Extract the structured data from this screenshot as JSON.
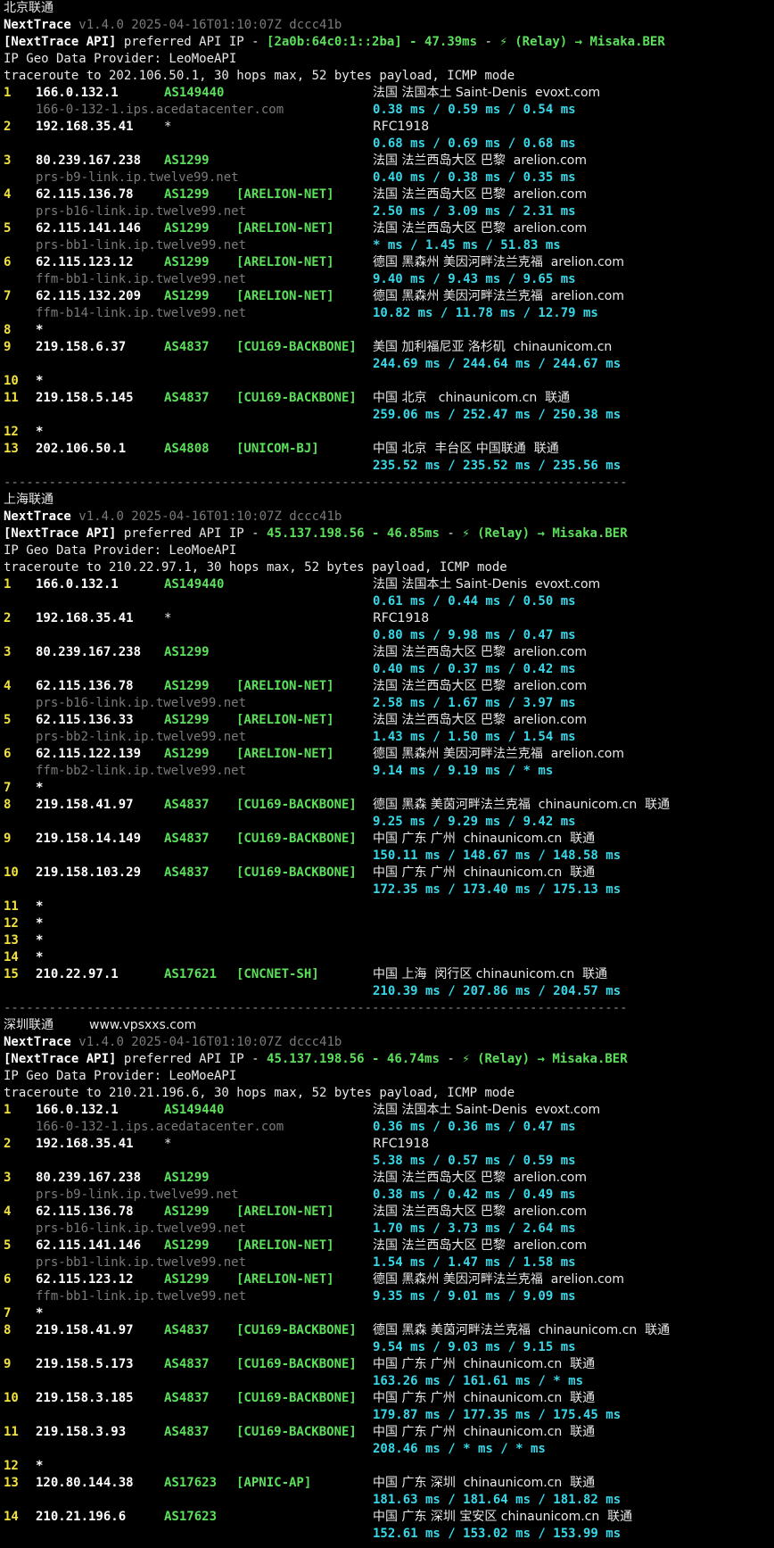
{
  "terminal": {
    "sections": [
      {
        "title": "北京联通",
        "note": "",
        "version": "v1.4.0 2025-04-16T01:10:07Z dccc41b",
        "api_ip": "[2a0b:64c0:1::2ba]",
        "api_latency": "47.39ms",
        "relay": "(Relay) → Misaka.BER",
        "geo_provider": "IP Geo Data Provider: LeoMoeAPI",
        "traceroute": "traceroute to 202.106.50.1, 30 hops max, 52 bytes payload, ICMP mode",
        "hops": [
          {
            "n": "1",
            "ip": "166.0.132.1",
            "as": "AS149440",
            "tag": "",
            "geo": "法国 法国本土 Saint-Denis  evoxt.com",
            "host": "166-0-132-1.ips.acedatacenter.com",
            "rtt": "0.38 ms / 0.59 ms / 0.54 ms"
          },
          {
            "n": "2",
            "ip": "192.168.35.41",
            "as": "*",
            "tag": "",
            "geo": "RFC1918",
            "host": "",
            "rtt": "0.68 ms / 0.69 ms / 0.68 ms"
          },
          {
            "n": "3",
            "ip": "80.239.167.238",
            "as": "AS1299",
            "tag": "",
            "geo": "法国 法兰西岛大区 巴黎  arelion.com",
            "host": "prs-b9-link.ip.twelve99.net",
            "rtt": "0.40 ms / 0.38 ms / 0.35 ms"
          },
          {
            "n": "4",
            "ip": "62.115.136.78",
            "as": "AS1299",
            "tag": "[ARELION-NET]",
            "geo": "法国 法兰西岛大区 巴黎  arelion.com",
            "host": "prs-b16-link.ip.twelve99.net",
            "rtt": "2.50 ms / 3.09 ms / 2.31 ms"
          },
          {
            "n": "5",
            "ip": "62.115.141.146",
            "as": "AS1299",
            "tag": "[ARELION-NET]",
            "geo": "法国 法兰西岛大区 巴黎  arelion.com",
            "host": "prs-bb1-link.ip.twelve99.net",
            "rtt": "* ms / 1.45 ms / 51.83 ms"
          },
          {
            "n": "6",
            "ip": "62.115.123.12",
            "as": "AS1299",
            "tag": "[ARELION-NET]",
            "geo": "德国 黑森州 美因河畔法兰克福  arelion.com",
            "host": "ffm-bb1-link.ip.twelve99.net",
            "rtt": "9.40 ms / 9.43 ms / 9.65 ms"
          },
          {
            "n": "7",
            "ip": "62.115.132.209",
            "as": "AS1299",
            "tag": "[ARELION-NET]",
            "geo": "德国 黑森州 美因河畔法兰克福  arelion.com",
            "host": "ffm-b14-link.ip.twelve99.net",
            "rtt": "10.82 ms / 11.78 ms / 12.79 ms"
          },
          {
            "n": "8",
            "ip": "*",
            "as": "",
            "tag": "",
            "geo": "",
            "host": "",
            "rtt": ""
          },
          {
            "n": "9",
            "ip": "219.158.6.37",
            "as": "AS4837",
            "tag": "[CU169-BACKBONE]",
            "geo": "美国 加利福尼亚 洛杉矶  chinaunicom.cn",
            "host": "",
            "rtt": "244.69 ms / 244.64 ms / 244.67 ms"
          },
          {
            "n": "10",
            "ip": "*",
            "as": "",
            "tag": "",
            "geo": "",
            "host": "",
            "rtt": ""
          },
          {
            "n": "11",
            "ip": "219.158.5.145",
            "as": "AS4837",
            "tag": "[CU169-BACKBONE]",
            "geo": "中国 北京   chinaunicom.cn  联通",
            "host": "",
            "rtt": "259.06 ms / 252.47 ms / 250.38 ms"
          },
          {
            "n": "12",
            "ip": "*",
            "as": "",
            "tag": "",
            "geo": "",
            "host": "",
            "rtt": ""
          },
          {
            "n": "13",
            "ip": "202.106.50.1",
            "as": "AS4808",
            "tag": "[UNICOM-BJ]",
            "geo": "中国 北京  丰台区 中国联通  联通",
            "host": "",
            "rtt": "235.52 ms / 235.52 ms / 235.56 ms"
          }
        ]
      },
      {
        "title": "上海联通",
        "note": "",
        "version": "v1.4.0 2025-04-16T01:10:07Z dccc41b",
        "api_ip": "45.137.198.56",
        "api_latency": "46.85ms",
        "relay": "(Relay) → Misaka.BER",
        "geo_provider": "IP Geo Data Provider: LeoMoeAPI",
        "traceroute": "traceroute to 210.22.97.1, 30 hops max, 52 bytes payload, ICMP mode",
        "hops": [
          {
            "n": "1",
            "ip": "166.0.132.1",
            "as": "AS149440",
            "tag": "",
            "geo": "法国 法国本土 Saint-Denis  evoxt.com",
            "host": "",
            "rtt": "0.61 ms / 0.44 ms / 0.50 ms"
          },
          {
            "n": "2",
            "ip": "192.168.35.41",
            "as": "*",
            "tag": "",
            "geo": "RFC1918",
            "host": "",
            "rtt": "0.80 ms / 9.98 ms / 0.47 ms"
          },
          {
            "n": "3",
            "ip": "80.239.167.238",
            "as": "AS1299",
            "tag": "",
            "geo": "法国 法兰西岛大区 巴黎  arelion.com",
            "host": "",
            "rtt": "0.40 ms / 0.37 ms / 0.42 ms"
          },
          {
            "n": "4",
            "ip": "62.115.136.78",
            "as": "AS1299",
            "tag": "[ARELION-NET]",
            "geo": "法国 法兰西岛大区 巴黎  arelion.com",
            "host": "prs-b16-link.ip.twelve99.net",
            "rtt": "2.58 ms / 1.67 ms / 3.97 ms"
          },
          {
            "n": "5",
            "ip": "62.115.136.33",
            "as": "AS1299",
            "tag": "[ARELION-NET]",
            "geo": "法国 法兰西岛大区 巴黎  arelion.com",
            "host": "prs-bb2-link.ip.twelve99.net",
            "rtt": "1.43 ms / 1.50 ms / 1.54 ms"
          },
          {
            "n": "6",
            "ip": "62.115.122.139",
            "as": "AS1299",
            "tag": "[ARELION-NET]",
            "geo": "德国 黑森州 美因河畔法兰克福  arelion.com",
            "host": "ffm-bb2-link.ip.twelve99.net",
            "rtt": "9.14 ms / 9.19 ms / * ms"
          },
          {
            "n": "7",
            "ip": "*",
            "as": "",
            "tag": "",
            "geo": "",
            "host": "",
            "rtt": ""
          },
          {
            "n": "8",
            "ip": "219.158.41.97",
            "as": "AS4837",
            "tag": "[CU169-BACKBONE]",
            "geo": "德国 黑森 美茵河畔法兰克福  chinaunicom.cn  联通",
            "host": "",
            "rtt": "9.25 ms / 9.29 ms / 9.42 ms"
          },
          {
            "n": "9",
            "ip": "219.158.14.149",
            "as": "AS4837",
            "tag": "[CU169-BACKBONE]",
            "geo": "中国 广东 广州  chinaunicom.cn  联通",
            "host": "",
            "rtt": "150.11 ms / 148.67 ms / 148.58 ms"
          },
          {
            "n": "10",
            "ip": "219.158.103.29",
            "as": "AS4837",
            "tag": "[CU169-BACKBONE]",
            "geo": "中国 广东 广州  chinaunicom.cn  联通",
            "host": "",
            "rtt": "172.35 ms / 173.40 ms / 175.13 ms"
          },
          {
            "n": "11",
            "ip": "*",
            "as": "",
            "tag": "",
            "geo": "",
            "host": "",
            "rtt": ""
          },
          {
            "n": "12",
            "ip": "*",
            "as": "",
            "tag": "",
            "geo": "",
            "host": "",
            "rtt": ""
          },
          {
            "n": "13",
            "ip": "*",
            "as": "",
            "tag": "",
            "geo": "",
            "host": "",
            "rtt": ""
          },
          {
            "n": "14",
            "ip": "*",
            "as": "",
            "tag": "",
            "geo": "",
            "host": "",
            "rtt": ""
          },
          {
            "n": "15",
            "ip": "210.22.97.1",
            "as": "AS17621",
            "tag": "[CNCNET-SH]",
            "geo": "中国 上海  闵行区 chinaunicom.cn  联通",
            "host": "",
            "rtt": "210.39 ms / 207.86 ms / 204.57 ms"
          }
        ]
      },
      {
        "title": "深圳联通",
        "note": "www.vpsxxs.com",
        "version": "v1.4.0 2025-04-16T01:10:07Z dccc41b",
        "api_ip": "45.137.198.56",
        "api_latency": "46.74ms",
        "relay": "(Relay) → Misaka.BER",
        "geo_provider": "IP Geo Data Provider: LeoMoeAPI",
        "traceroute": "traceroute to 210.21.196.6, 30 hops max, 52 bytes payload, ICMP mode",
        "hops": [
          {
            "n": "1",
            "ip": "166.0.132.1",
            "as": "AS149440",
            "tag": "",
            "geo": "法国 法国本土 Saint-Denis  evoxt.com",
            "host": "166-0-132-1.ips.acedatacenter.com",
            "rtt": "0.36 ms / 0.36 ms / 0.47 ms"
          },
          {
            "n": "2",
            "ip": "192.168.35.41",
            "as": "*",
            "tag": "",
            "geo": "RFC1918",
            "host": "",
            "rtt": "5.38 ms / 0.57 ms / 0.59 ms"
          },
          {
            "n": "3",
            "ip": "80.239.167.238",
            "as": "AS1299",
            "tag": "",
            "geo": "法国 法兰西岛大区 巴黎  arelion.com",
            "host": "prs-b9-link.ip.twelve99.net",
            "rtt": "0.38 ms / 0.42 ms / 0.49 ms"
          },
          {
            "n": "4",
            "ip": "62.115.136.78",
            "as": "AS1299",
            "tag": "[ARELION-NET]",
            "geo": "法国 法兰西岛大区 巴黎  arelion.com",
            "host": "prs-b16-link.ip.twelve99.net",
            "rtt": "1.70 ms / 3.73 ms / 2.64 ms"
          },
          {
            "n": "5",
            "ip": "62.115.141.146",
            "as": "AS1299",
            "tag": "[ARELION-NET]",
            "geo": "法国 法兰西岛大区 巴黎  arelion.com",
            "host": "prs-bb1-link.ip.twelve99.net",
            "rtt": "1.54 ms / 1.47 ms / 1.58 ms"
          },
          {
            "n": "6",
            "ip": "62.115.123.12",
            "as": "AS1299",
            "tag": "[ARELION-NET]",
            "geo": "德国 黑森州 美因河畔法兰克福  arelion.com",
            "host": "ffm-bb1-link.ip.twelve99.net",
            "rtt": "9.35 ms / 9.01 ms / 9.09 ms"
          },
          {
            "n": "7",
            "ip": "*",
            "as": "",
            "tag": "",
            "geo": "",
            "host": "",
            "rtt": ""
          },
          {
            "n": "8",
            "ip": "219.158.41.97",
            "as": "AS4837",
            "tag": "[CU169-BACKBONE]",
            "geo": "德国 黑森 美茵河畔法兰克福  chinaunicom.cn  联通",
            "host": "",
            "rtt": "9.54 ms / 9.03 ms / 9.15 ms"
          },
          {
            "n": "9",
            "ip": "219.158.5.173",
            "as": "AS4837",
            "tag": "[CU169-BACKBONE]",
            "geo": "中国 广东 广州  chinaunicom.cn  联通",
            "host": "",
            "rtt": "163.26 ms / 161.61 ms / * ms"
          },
          {
            "n": "10",
            "ip": "219.158.3.185",
            "as": "AS4837",
            "tag": "[CU169-BACKBONE]",
            "geo": "中国 广东 广州  chinaunicom.cn  联通",
            "host": "",
            "rtt": "179.87 ms / 177.35 ms / 175.45 ms"
          },
          {
            "n": "11",
            "ip": "219.158.3.93",
            "as": "AS4837",
            "tag": "[CU169-BACKBONE]",
            "geo": "中国 广东 广州  chinaunicom.cn  联通",
            "host": "",
            "rtt": "208.46 ms / * ms / * ms"
          },
          {
            "n": "12",
            "ip": "*",
            "as": "",
            "tag": "",
            "geo": "",
            "host": "",
            "rtt": ""
          },
          {
            "n": "13",
            "ip": "120.80.144.38",
            "as": "AS17623",
            "tag": "[APNIC-AP]",
            "geo": "中国 广东 深圳  chinaunicom.cn  联通",
            "host": "",
            "rtt": "181.63 ms / 181.64 ms / 181.82 ms"
          },
          {
            "n": "14",
            "ip": "210.21.196.6",
            "as": "AS17623",
            "tag": "",
            "geo": "中国 广东 深圳 宝安区 chinaunicom.cn  联通",
            "host": "",
            "rtt": "152.61 ms / 153.02 ms / 153.99 ms"
          }
        ]
      }
    ],
    "labels": {
      "app_name": "NextTrace",
      "api_prefix": "[NextTrace API]",
      "api_text": " preferred API IP - ",
      "dash": " - ",
      "relay_icon": "⚡",
      "separator": "-----------------------------------------------------------------------------------"
    },
    "colors": {
      "background": "#000000",
      "hop_number": "#f2e23c",
      "asn": "#5ce05c",
      "rtt": "#38d8e8",
      "hostname": "#7a7a7a"
    }
  }
}
